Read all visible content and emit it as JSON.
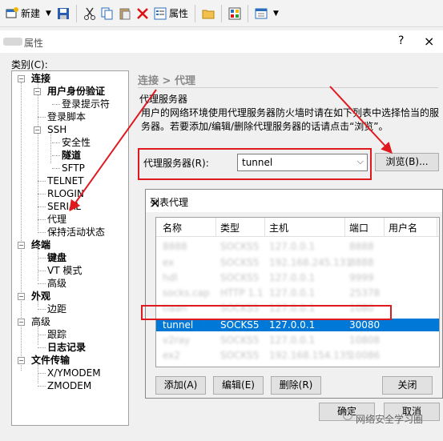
{
  "toolbar": {
    "new_label": "新建",
    "properties_label": "属性",
    "icons": [
      "new-session-icon",
      "save-icon",
      "cut-icon",
      "copy-icon",
      "paste-icon",
      "delete-icon",
      "properties-icon",
      "folder-icon",
      "tool-icon",
      "window-icon"
    ]
  },
  "dialog": {
    "title": "属性",
    "help": "?",
    "close": "×",
    "category_label": "类别(C):",
    "tree": [
      {
        "label": "连接",
        "bold": true
      },
      {
        "label": "用户身份验证",
        "bold": true
      },
      {
        "label": "登录提示符",
        "bold": false
      },
      {
        "label": "登录脚本",
        "bold": false
      },
      {
        "label": "SSH",
        "bold": false
      },
      {
        "label": "安全性",
        "bold": false
      },
      {
        "label": "隧道",
        "bold": true
      },
      {
        "label": "SFTP",
        "bold": false
      },
      {
        "label": "TELNET",
        "bold": false
      },
      {
        "label": "RLOGIN",
        "bold": false
      },
      {
        "label": "SERIAL",
        "bold": false
      },
      {
        "label": "代理",
        "bold": false
      },
      {
        "label": "保持活动状态",
        "bold": false
      },
      {
        "label": "终端",
        "bold": true
      },
      {
        "label": "键盘",
        "bold": true
      },
      {
        "label": "VT 模式",
        "bold": false
      },
      {
        "label": "高级",
        "bold": false
      },
      {
        "label": "外观",
        "bold": true
      },
      {
        "label": "边距",
        "bold": false
      },
      {
        "label": "高级",
        "bold": false
      },
      {
        "label": "跟踪",
        "bold": false
      },
      {
        "label": "日志记录",
        "bold": true
      },
      {
        "label": "文件传输",
        "bold": true
      },
      {
        "label": "X/YMODEM",
        "bold": false
      },
      {
        "label": "ZMODEM",
        "bold": false
      }
    ],
    "breadcrumb": "连接 > 代理",
    "section_label": "代理服务器",
    "description": "用户的网络环境使用代理服务器防火墙时请在如下列表中选择恰当的服务器。若要添加/编辑/删除代理服务器的话请点击“浏览”。",
    "proxy_label": "代理服务器(R):",
    "proxy_value": "tunnel",
    "browse_button": "浏览(B)...",
    "ok_button": "确定",
    "cancel_button": "取消"
  },
  "proxy_list": {
    "title": "列表代理",
    "close": "×",
    "columns": [
      "名称",
      "类型",
      "主机",
      "端口",
      "用户名"
    ],
    "rows": [
      {
        "name": "8888",
        "type": "SOCKS5",
        "host": "127.0.0.1",
        "port": "8888",
        "user": "",
        "blurred": true
      },
      {
        "name": "ex",
        "type": "SOCKS5",
        "host": "192.168.245.131",
        "port": "8888",
        "user": "",
        "blurred": true
      },
      {
        "name": "hdl",
        "type": "SOCKS5",
        "host": "127.0.0.1",
        "port": "9999",
        "user": "",
        "blurred": true
      },
      {
        "name": "socks.cap",
        "type": "HTTP 1.1",
        "host": "127.0.0.1",
        "port": "25378",
        "user": "",
        "blurred": true
      },
      {
        "name": "tiaan",
        "type": "SOCKS5",
        "host": "127.0.0.1",
        "port": "1080",
        "user": "",
        "blurred": true
      },
      {
        "name": "tunnel",
        "type": "SOCKS5",
        "host": "127.0.0.1",
        "port": "30080",
        "user": "",
        "blurred": false,
        "selected": true
      },
      {
        "name": "v2ray",
        "type": "SOCKS5",
        "host": "127.0.0.1",
        "port": "10808",
        "user": "",
        "blurred": true
      },
      {
        "name": "ex2",
        "type": "SOCKS5",
        "host": "192.168.154.135",
        "port": "10086",
        "user": "",
        "blurred": true
      }
    ],
    "add_button": "添加(A)",
    "edit_button": "编辑(E)",
    "delete_button": "删除(R)",
    "close_button": "关闭"
  },
  "watermark": "网络安全学习圈",
  "colors": {
    "selection": "#0078d7",
    "annotation": "#e0191f"
  }
}
